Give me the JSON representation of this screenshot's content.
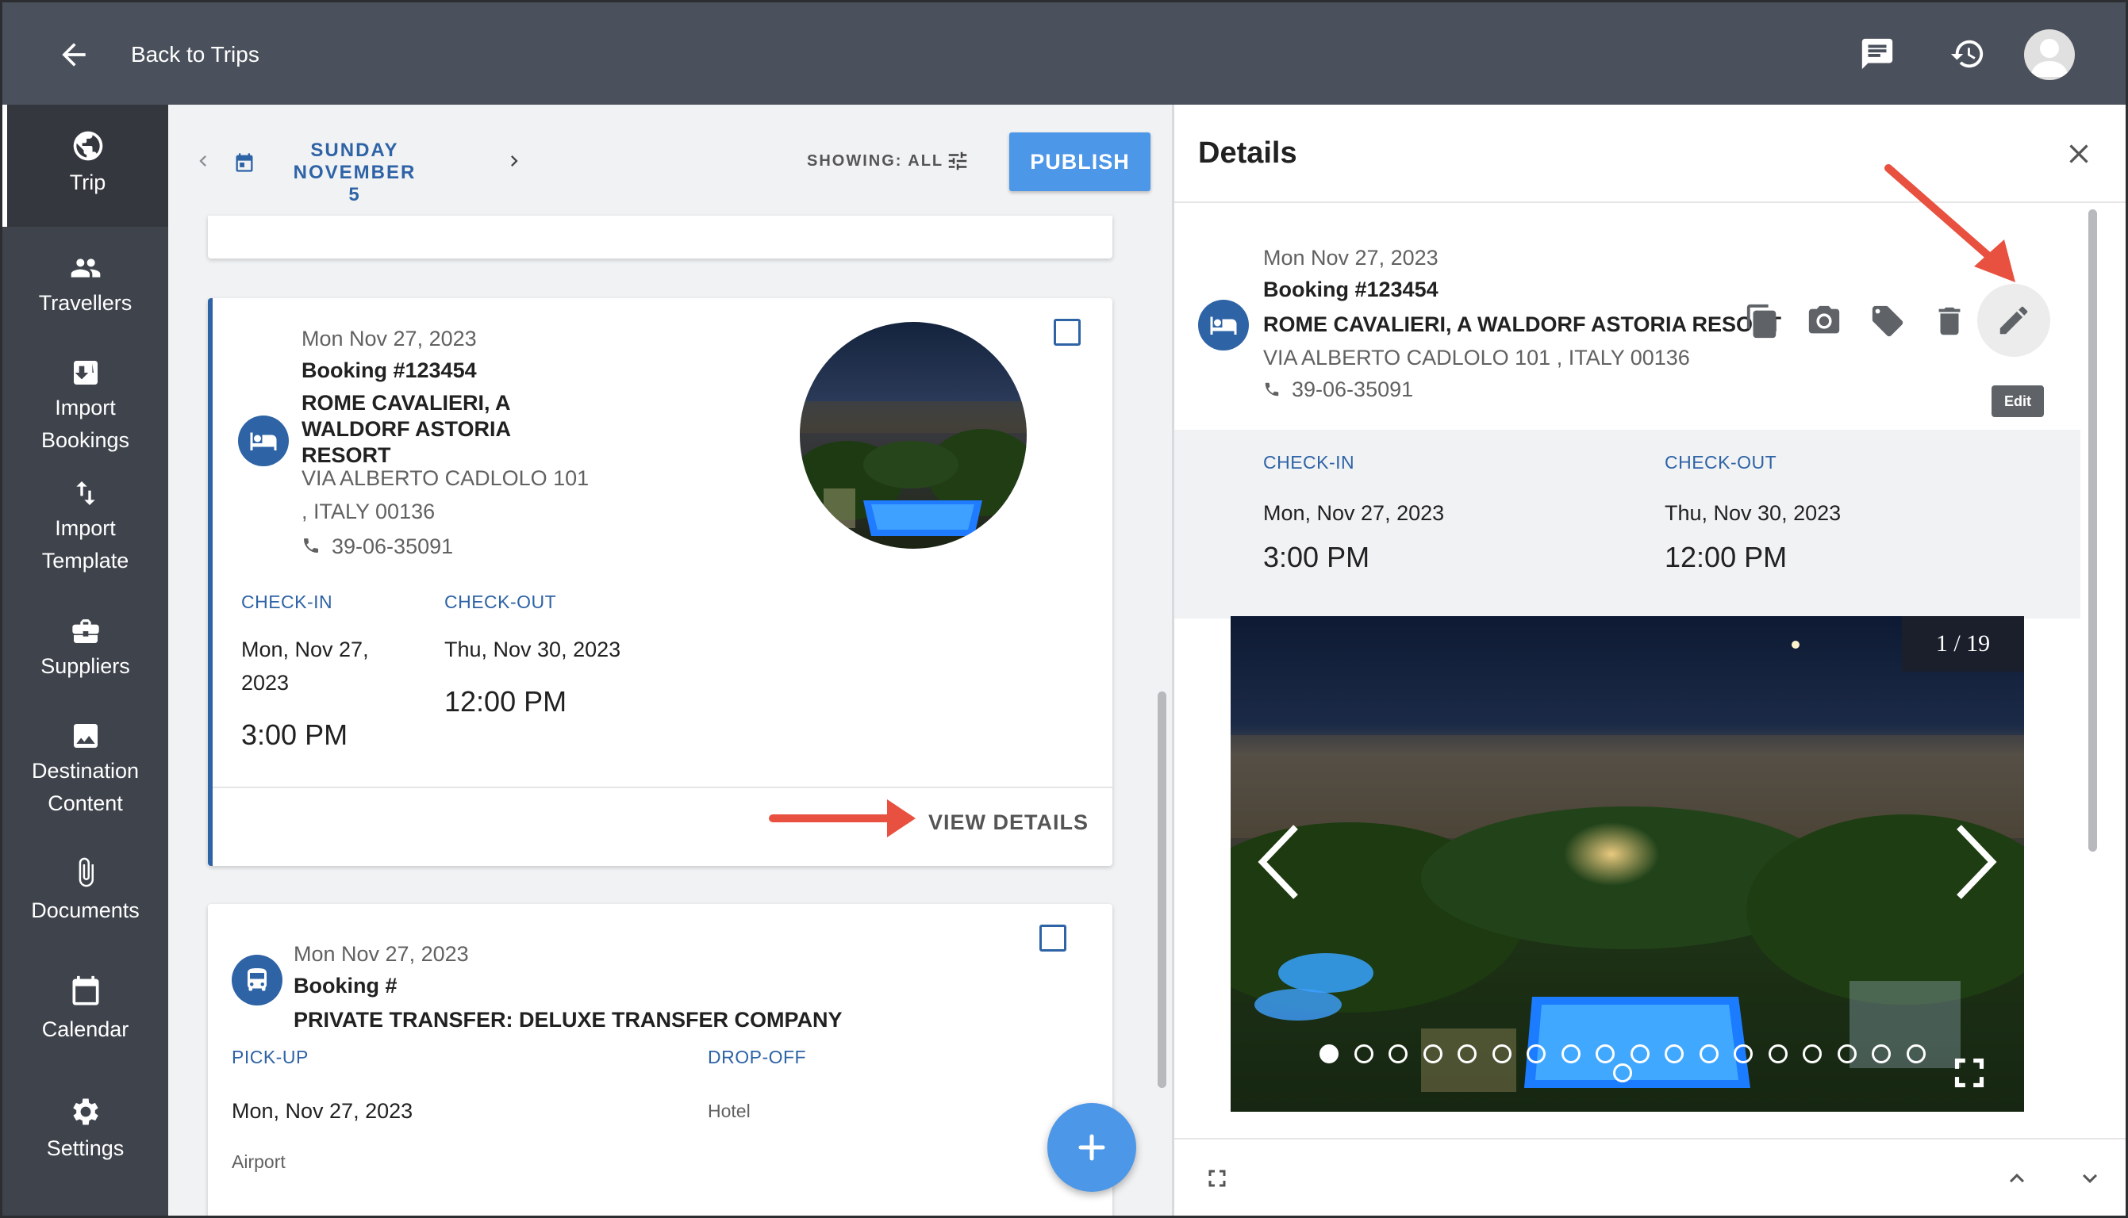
{
  "topbar": {
    "back_label": "Back to Trips"
  },
  "sidebar": {
    "items": [
      {
        "label": "Trip",
        "icon": "globe-icon"
      },
      {
        "label": "Travellers",
        "icon": "people-icon"
      },
      {
        "label": "Import Bookings",
        "icon": "download-box-icon"
      },
      {
        "label": "Import Template",
        "icon": "swap-vertical-icon"
      },
      {
        "label": "Suppliers",
        "icon": "briefcase-icon"
      },
      {
        "label": "Destination Content",
        "icon": "image-icon"
      },
      {
        "label": "Documents",
        "icon": "paperclip-icon"
      },
      {
        "label": "Calendar",
        "icon": "calendar-icon"
      },
      {
        "label": "Settings",
        "icon": "gear-icon"
      }
    ]
  },
  "datebar": {
    "date_line1": "SUNDAY NOVEMBER",
    "date_line2": "5",
    "showing": "SHOWING: ALL",
    "publish": "PUBLISH"
  },
  "hotel_card": {
    "date": "Mon Nov 27, 2023",
    "booking": "Booking #123454",
    "name_line1": "ROME CAVALIERI, A",
    "name_line2": "WALDORF ASTORIA",
    "name_line3": "RESORT",
    "address_line1": "VIA ALBERTO CADLOLO 101",
    "address_line2": ", ITALY 00136",
    "phone": "39-06-35091",
    "checkin_label": "CHECK-IN",
    "checkin_date_line1": "Mon, Nov 27,",
    "checkin_date_line2": "2023",
    "checkin_time": "3:00 PM",
    "checkout_label": "CHECK-OUT",
    "checkout_date": "Thu, Nov 30, 2023",
    "checkout_time": "12:00 PM",
    "view_details": "VIEW DETAILS"
  },
  "transfer_card": {
    "date": "Mon Nov 27, 2023",
    "booking": "Booking #",
    "name": "PRIVATE TRANSFER: DELUXE TRANSFER COMPANY",
    "pickup_label": "PICK-UP",
    "pickup_date": "Mon, Nov 27, 2023",
    "pickup_place": "Airport",
    "dropoff_label": "DROP-OFF",
    "dropoff_place": "Hotel"
  },
  "details": {
    "title": "Details",
    "date": "Mon Nov 27, 2023",
    "booking": "Booking #123454",
    "name": "ROME CAVALIERI, A WALDORF ASTORIA RESORT",
    "address": "VIA ALBERTO CADLOLO 101 , ITALY 00136",
    "phone": "39-06-35091",
    "edit_tooltip": "Edit",
    "checkin_label": "CHECK-IN",
    "checkin_date": "Mon, Nov 27, 2023",
    "checkin_time": "3:00 PM",
    "checkout_label": "CHECK-OUT",
    "checkout_date": "Thu, Nov 30, 2023",
    "checkout_time": "12:00 PM",
    "gallery_counter": "1 / 19",
    "gallery_total": 19,
    "gallery_current": 1
  },
  "colors": {
    "accent": "#2e63a6",
    "publish": "#4c97e8",
    "topbar": "#4b515c",
    "sidebar": "#3f434c",
    "annotation_arrow": "#e8513f"
  }
}
